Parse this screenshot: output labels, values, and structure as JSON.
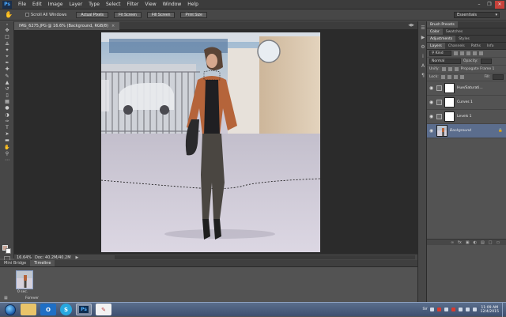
{
  "menubar": {
    "app_logo": "Ps",
    "items": [
      "File",
      "Edit",
      "Image",
      "Layer",
      "Type",
      "Select",
      "Filter",
      "View",
      "Window",
      "Help"
    ],
    "window_controls": [
      "minimize",
      "restore",
      "close"
    ]
  },
  "options_bar": {
    "tool_icon": "hand-icon",
    "scroll_all_windows_label": "Scroll All Windows",
    "scroll_all_windows_checked": false,
    "buttons": [
      "Actual Pixels",
      "Fit Screen",
      "Fill Screen",
      "Print Size"
    ],
    "workspace": "Essentials"
  },
  "document": {
    "tab_title": "IMG_6275.JPG @ 16.6% (Background, RGB/8)",
    "zoom": "16.64%",
    "doc_info": "Doc: 40.2M/40.2M"
  },
  "bottom_panel": {
    "tabs": [
      "Mini Bridge",
      "Timeline"
    ],
    "active_tab": "Timeline",
    "frame_time": "0 sec.",
    "loop": "Forever"
  },
  "right_panels": {
    "group1_tabs": [
      "Brush Presets"
    ],
    "group2_tabs": [
      "Color",
      "Swatches"
    ],
    "group3_tabs": [
      "Adjustments",
      "Styles"
    ],
    "group4_tabs": [
      "Layers",
      "Channels",
      "Paths",
      "Info"
    ],
    "filter_kind": "Kind",
    "blend_mode": "Normal",
    "opacity_label": "Opacity:",
    "unify_label": "Unify:",
    "propagate_label": "Propagate Frame 1",
    "lock_label": "Lock:",
    "fill_label": "Fill:",
    "layers": [
      {
        "name": "Hue/Saturati...",
        "type": "adjustment",
        "selected": false
      },
      {
        "name": "Curves 1",
        "type": "adjustment",
        "selected": false
      },
      {
        "name": "Levels 1",
        "type": "adjustment",
        "selected": false
      },
      {
        "name": "Background",
        "type": "image",
        "selected": true
      }
    ]
  },
  "taskbar": {
    "apps": [
      "explorer",
      "outlook",
      "skype",
      "photoshop",
      "paint"
    ],
    "active_app": "photoshop",
    "tray_lang": "SV",
    "time": "11:09 AM",
    "date": "12/4/2015"
  },
  "colors": {
    "foreground_swatch": "#c9a597",
    "background_swatch": "#ffffff",
    "selected_layer": "#5b6d8d"
  }
}
